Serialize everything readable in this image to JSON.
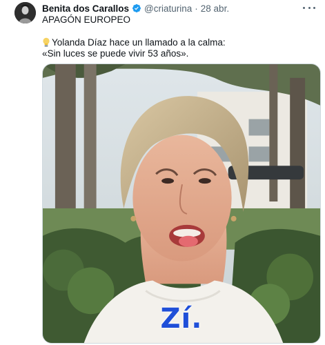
{
  "tweet": {
    "display_name": "Benita dos Carallos",
    "handle": "@criaturina",
    "separator": "·",
    "timestamp": "28 abr.",
    "text_line1": "APAGÓN EUROPEO",
    "text_line2": "Yolanda Díaz hace un llamado a la calma:",
    "text_line3": "«Sin luces se puede vivir 53 años».",
    "media_caption": "Zí.",
    "icons": {
      "verified": "verified-badge-icon",
      "more": "more-options-icon",
      "bulb": "light-bulb-icon"
    },
    "colors": {
      "verified": "#1d9bf0",
      "caption": "#1f4fd8",
      "secondary_text": "#536471"
    }
  }
}
